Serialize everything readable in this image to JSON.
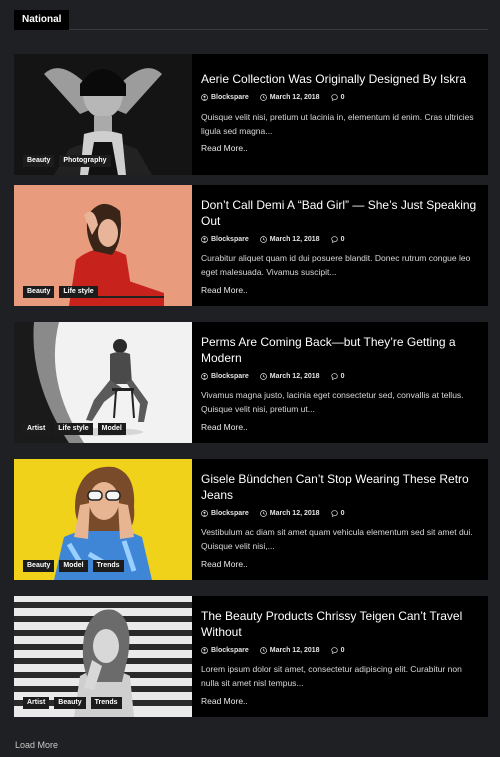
{
  "section": {
    "tab_label": "National"
  },
  "posts": [
    {
      "title": "Aerie Collection Was Originally Designed By Iskra",
      "author": "Blockspare",
      "date": "March 12, 2018",
      "comments": "0",
      "excerpt": "Quisque velit nisi, pretium ut lacinia in, elementum id enim. Cras ultricies ligula sed magna...",
      "read_more": "Read More..",
      "tags": [
        "Beauty",
        "Photography"
      ]
    },
    {
      "title": "Don’t Call Demi A “Bad Girl” — She’s Just Speaking Out",
      "author": "Blockspare",
      "date": "March 12, 2018",
      "comments": "0",
      "excerpt": "Curabitur aliquet quam id dui posuere blandit. Donec rutrum congue leo eget malesuada. Vivamus suscipit...",
      "read_more": "Read More..",
      "tags": [
        "Beauty",
        "Life style"
      ]
    },
    {
      "title": "Perms Are Coming Back—but They’re Getting a Modern",
      "author": "Blockspare",
      "date": "March 12, 2018",
      "comments": "0",
      "excerpt": "Vivamus magna justo, lacinia eget consectetur sed, convallis at tellus. Quisque velit nisi, pretium ut...",
      "read_more": "Read More..",
      "tags": [
        "Artist",
        "Life style",
        "Model"
      ]
    },
    {
      "title": "Gisele Bündchen Can’t Stop Wearing These Retro Jeans",
      "author": "Blockspare",
      "date": "March 12, 2018",
      "comments": "0",
      "excerpt": "Vestibulum ac diam sit amet quam vehicula elementum sed sit amet dui. Quisque velit nisi,...",
      "read_more": "Read More..",
      "tags": [
        "Beauty",
        "Model",
        "Trends"
      ]
    },
    {
      "title": "The Beauty Products Chrissy Teigen Can’t Travel Without",
      "author": "Blockspare",
      "date": "March 12, 2018",
      "comments": "0",
      "excerpt": "Lorem ipsum dolor sit amet, consectetur adipiscing elit. Curabitur non nulla sit amet nisl tempus...",
      "read_more": "Read More..",
      "tags": [
        "Artist",
        "Beauty",
        "Trends"
      ]
    }
  ],
  "load_more": "Load More",
  "icons": {
    "author": "user-circle-icon",
    "date": "clock-icon",
    "comments": "comment-icon"
  },
  "colors": {
    "background": "#1f2023",
    "card": "#000000",
    "tag": "#1c1c1c"
  }
}
